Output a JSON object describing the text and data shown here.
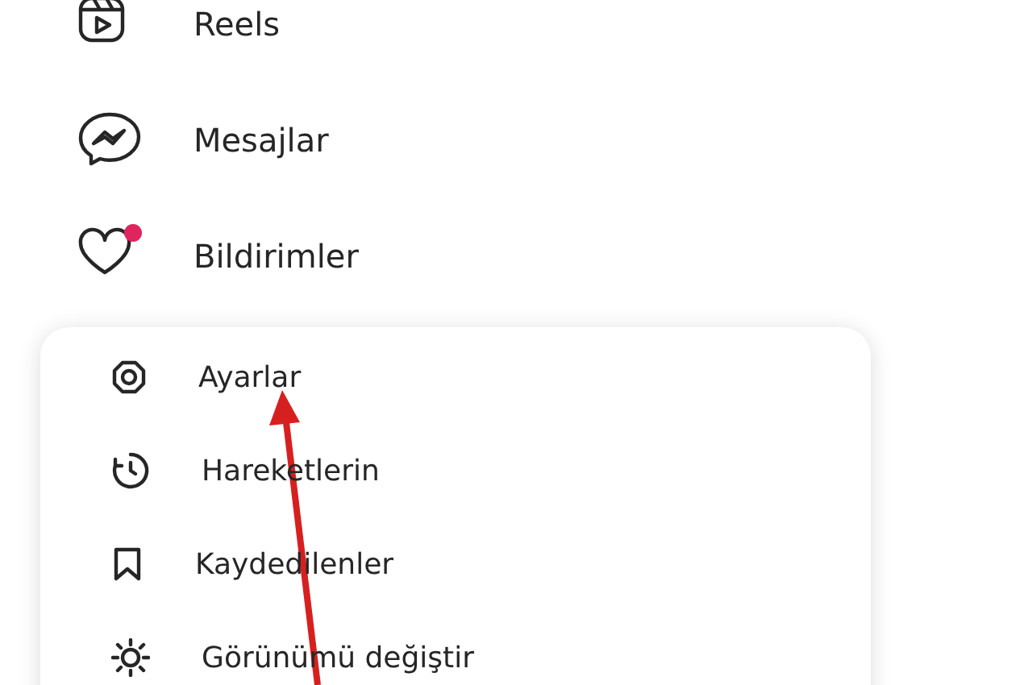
{
  "sidebar": {
    "items": [
      {
        "label": "Reels",
        "kind": "reels",
        "badge": false
      },
      {
        "label": "Mesajlar",
        "kind": "messages",
        "badge": false
      },
      {
        "label": "Bildirimler",
        "kind": "notifications",
        "badge": true
      }
    ]
  },
  "menu": {
    "items": [
      {
        "label": "Ayarlar",
        "kind": "settings"
      },
      {
        "label": "Hareketlerin",
        "kind": "activity"
      },
      {
        "label": "Kaydedilenler",
        "kind": "saved"
      },
      {
        "label": "Görünümü değiştir",
        "kind": "appearance"
      }
    ]
  }
}
